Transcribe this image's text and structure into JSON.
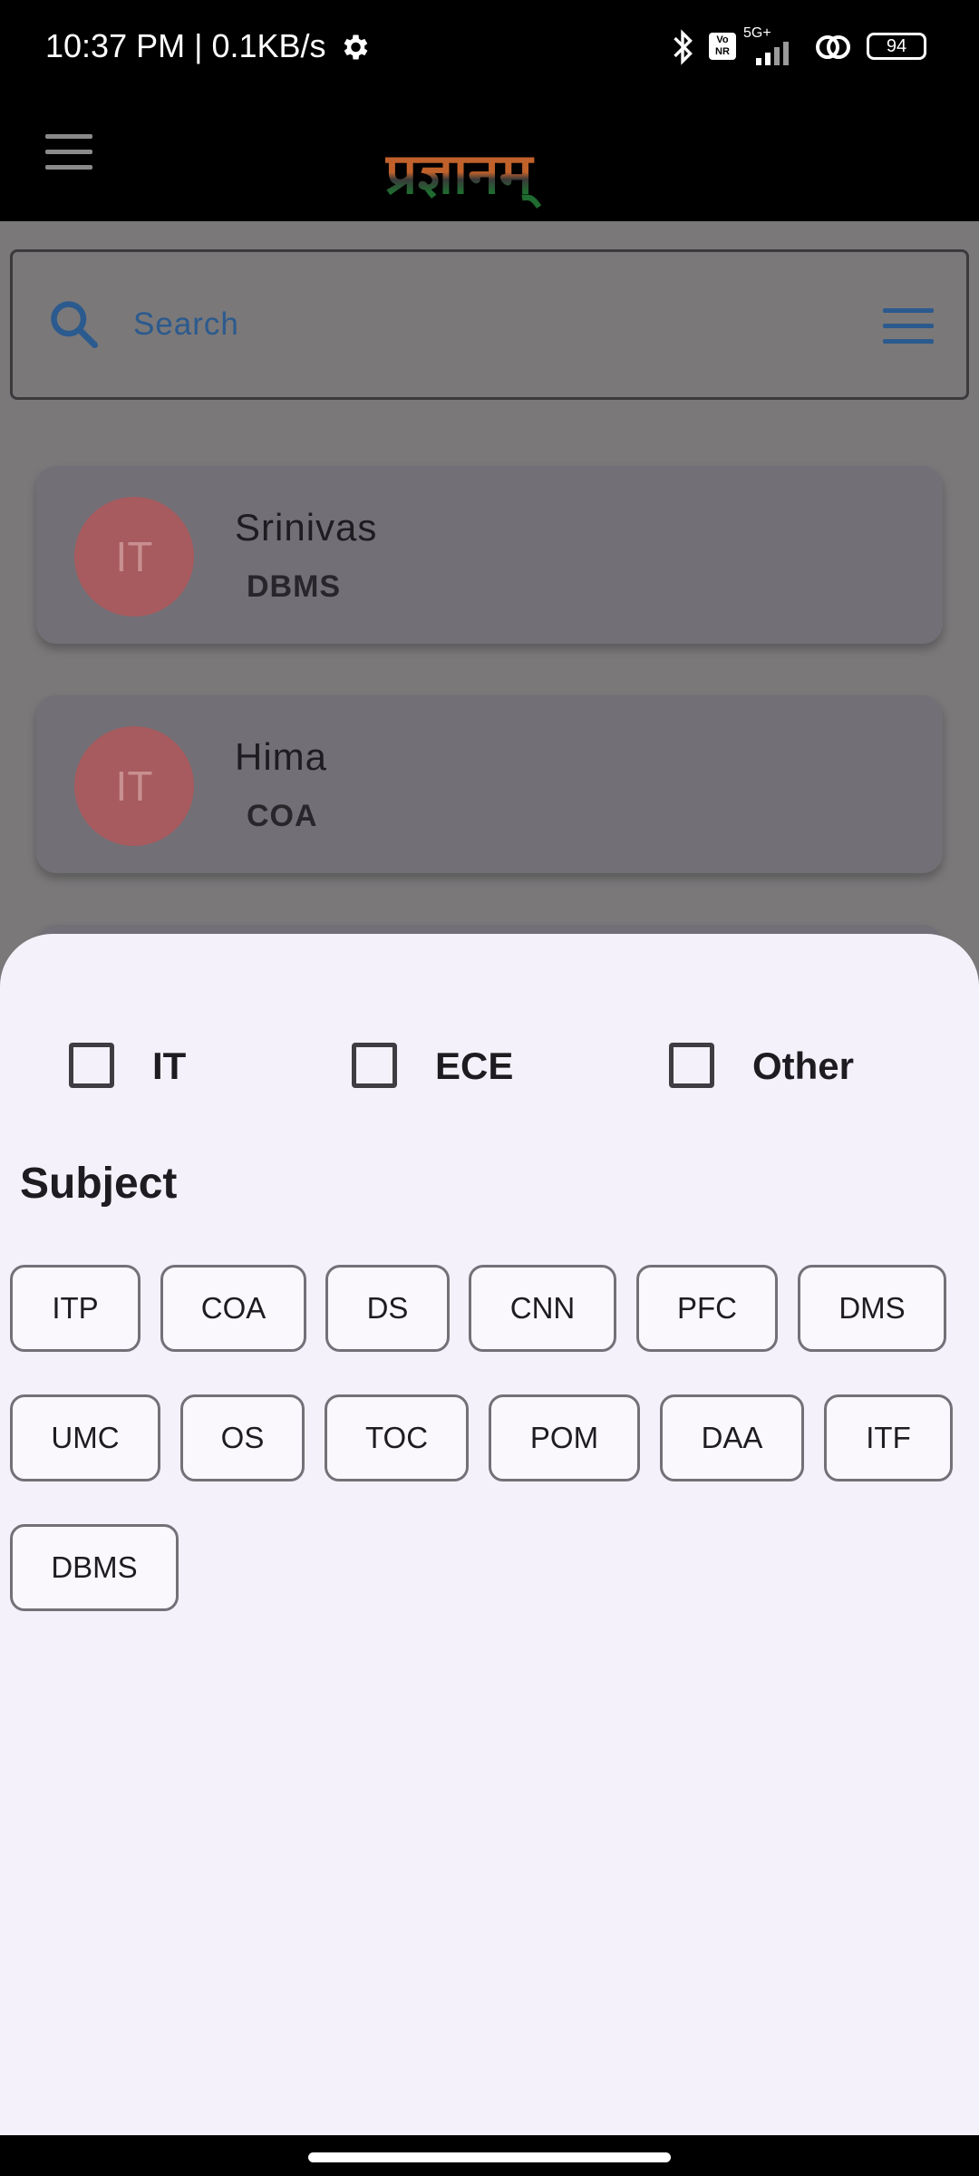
{
  "status_bar": {
    "time": "10:37 PM | 0.1KB/s",
    "network_type": "5G+",
    "volte": "Vo NR",
    "battery": "94",
    "icons": [
      "settings-gear-icon",
      "bluetooth-icon",
      "volte-icon",
      "signal-icon",
      "hotspot-icon",
      "battery-icon"
    ]
  },
  "app_bar": {
    "menu_icon": "hamburger-menu-icon",
    "logo_text": "प्रज्ञानम्"
  },
  "search": {
    "placeholder": "Search",
    "icon": "search-icon",
    "filter_icon": "filter-menu-icon"
  },
  "cards": [
    {
      "avatar": "IT",
      "name": "Srinivas",
      "subject": "DBMS"
    },
    {
      "avatar": "IT",
      "name": "Hima",
      "subject": "COA"
    }
  ],
  "filter_sheet": {
    "departments": [
      {
        "label": "IT",
        "checked": false
      },
      {
        "label": "ECE",
        "checked": false
      },
      {
        "label": "Other",
        "checked": false
      }
    ],
    "subject_heading": "Subject",
    "subjects": [
      "ITP",
      "COA",
      "DS",
      "CNN",
      "PFC",
      "DMS",
      "UMC",
      "OS",
      "TOC",
      "POM",
      "DAA",
      "ITF",
      "DBMS"
    ]
  },
  "colors": {
    "accent": "#2b5a8e",
    "avatar_bg": "#a75b5e",
    "sheet_bg": "#f5f1fa",
    "overlay": "#7a7879"
  }
}
